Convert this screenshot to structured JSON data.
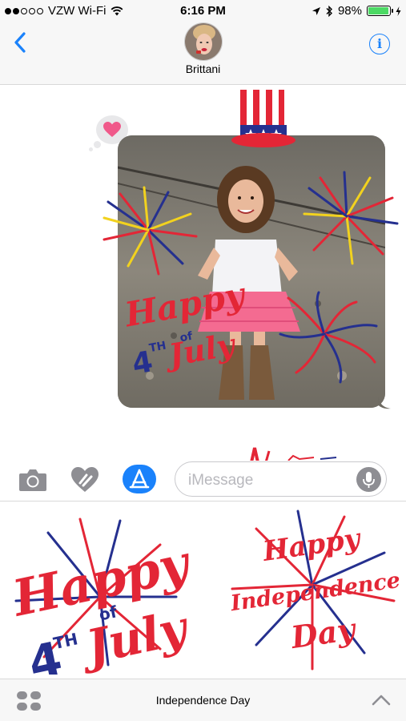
{
  "status_bar": {
    "carrier": "VZW Wi-Fi",
    "signal_dots_filled": 2,
    "signal_dots_total": 5,
    "time": "6:16 PM",
    "battery": "98%",
    "battery_level": 0.98,
    "icons": [
      "wifi-icon",
      "location-arrow-icon",
      "bluetooth-icon",
      "battery-icon",
      "charging-bolt-icon"
    ]
  },
  "header": {
    "contact_name": "Brittani",
    "info_label": "i"
  },
  "conversation": {
    "tapback_reaction": "heart",
    "photo_stickers": {
      "main_lines": [
        "Happy",
        "of",
        "4",
        "TH",
        "July"
      ]
    }
  },
  "input": {
    "placeholder": "iMessage"
  },
  "drawer": {
    "sticker_1": {
      "lines": [
        "Happy",
        "of",
        "4",
        "TH",
        "July"
      ]
    },
    "sticker_2": {
      "lines": [
        "Happy",
        "Independence",
        "Day"
      ]
    }
  },
  "bottom_bar": {
    "app_name": "Independence Day"
  },
  "colors": {
    "accent_blue": "#1a82fb",
    "sticker_red": "#e32636",
    "sticker_navy": "#25308f",
    "battery_green": "#4cd964",
    "tapback_heart": "#f0598a"
  }
}
